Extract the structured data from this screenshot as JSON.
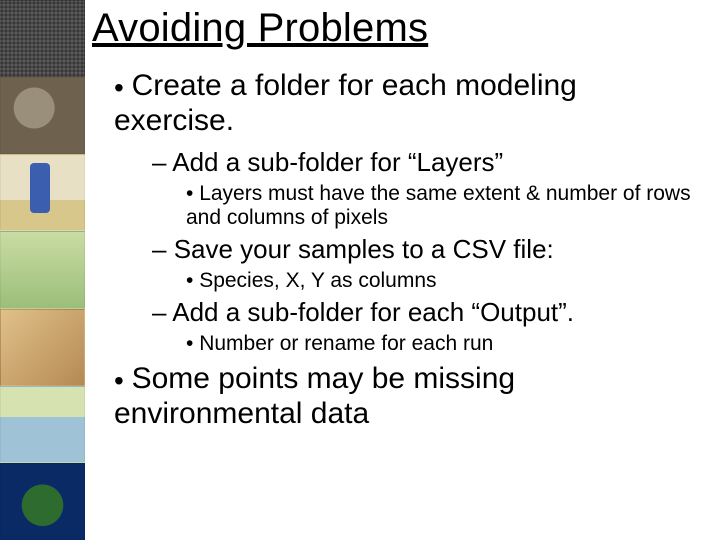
{
  "title": "Avoiding Problems",
  "bullets": {
    "b1": "Create a folder for each modeling exercise.",
    "b1a": "Add a sub-folder for “Layers”",
    "b1a1": "Layers must have the same extent & number of rows and columns of pixels",
    "b1b": "Save your samples to a CSV file:",
    "b1b1": "Species, X, Y as columns",
    "b1c": "Add a sub-folder for each “Output”.",
    "b1c1": "Number or rename for each run",
    "b2": "Some points may be missing environmental data"
  }
}
